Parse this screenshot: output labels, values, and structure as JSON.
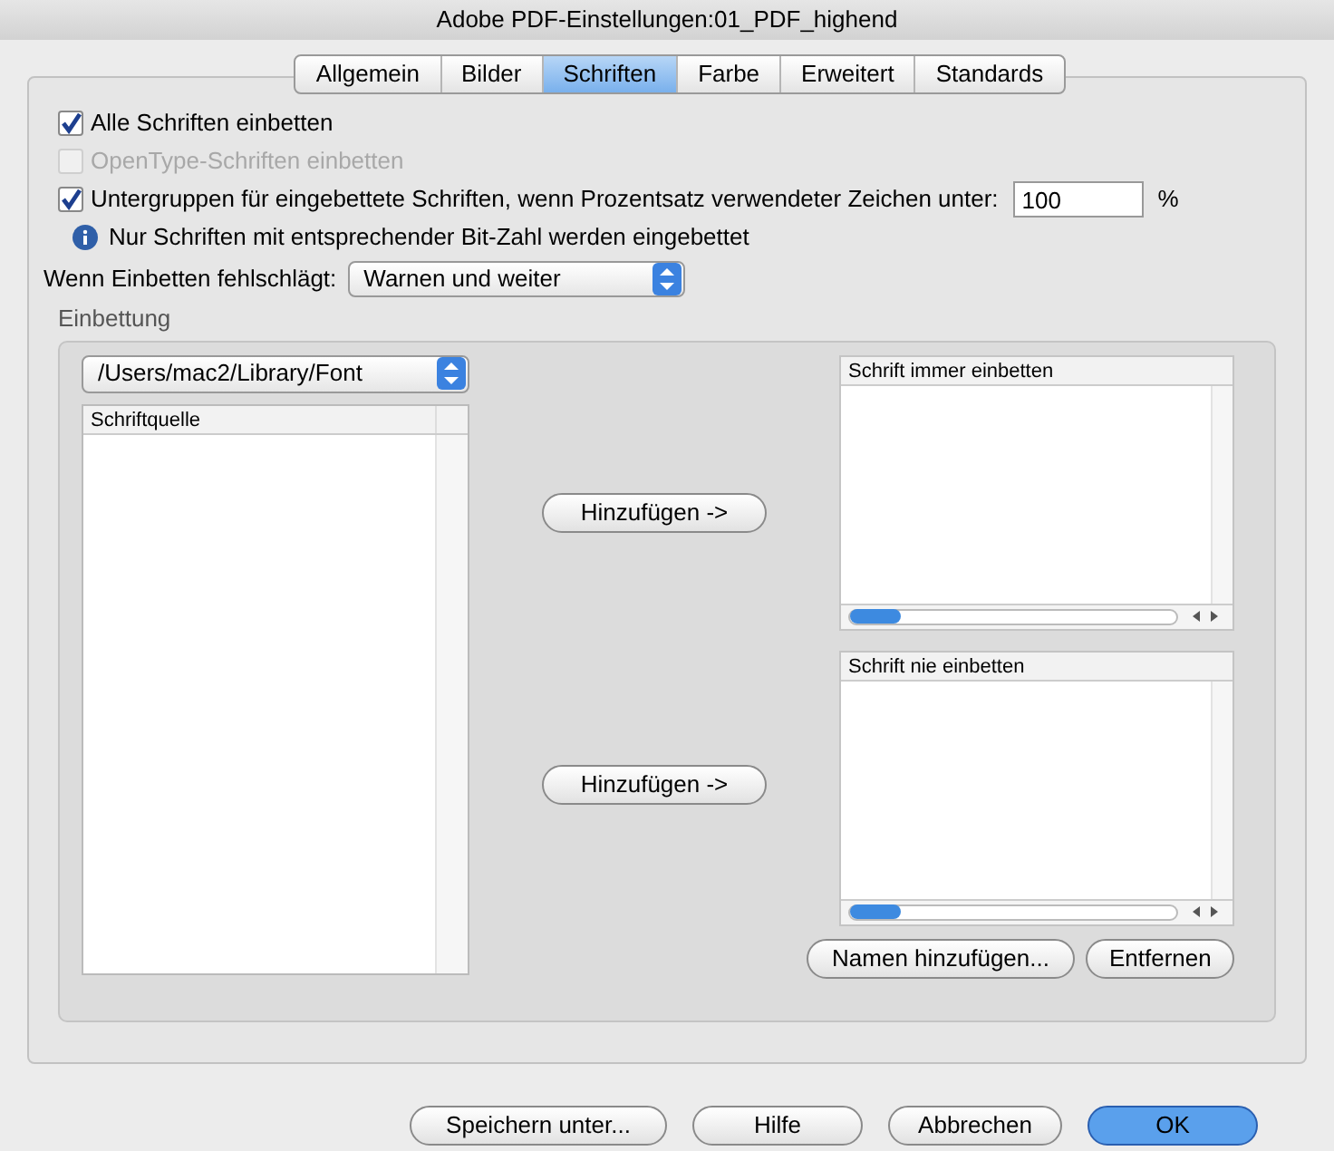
{
  "window": {
    "title": "Adobe PDF-Einstellungen:01_PDF_highend"
  },
  "tabs": [
    {
      "label": "Allgemein",
      "selected": false
    },
    {
      "label": "Bilder",
      "selected": false
    },
    {
      "label": "Schriften",
      "selected": true
    },
    {
      "label": "Farbe",
      "selected": false
    },
    {
      "label": "Erweitert",
      "selected": false
    },
    {
      "label": "Standards",
      "selected": false
    }
  ],
  "options": [
    {
      "kind": "checkbox",
      "label": "Alle Schriften einbetten",
      "checked": true,
      "disabled": false
    },
    {
      "kind": "checkbox",
      "label": "OpenType-Schriften einbetten",
      "checked": false,
      "disabled": true
    },
    {
      "kind": "checkbox_field",
      "label": "Untergruppen für eingebettete Schriften, wenn Prozentsatz verwendeter Zeichen unter:",
      "checked": true,
      "disabled": false,
      "value": "100",
      "unit": "%"
    },
    {
      "kind": "info",
      "label": "Nur Schriften mit entsprechender Bit-Zahl werden eingebettet"
    }
  ],
  "failure": {
    "label": "Wenn Einbetten fehlschlägt:",
    "value": "Warnen und weiter"
  },
  "embedding": {
    "title": "Einbettung",
    "folder": "/Users/mac2/Library/Font",
    "source_header": "Schriftquelle",
    "add_buttons": [
      "Hinzufügen ->",
      "Hinzufügen ->"
    ],
    "always_header": "Schrift immer einbetten",
    "never_header": "Schrift nie einbetten",
    "list_buttons": [
      "Namen hinzufügen...",
      "Entfernen"
    ]
  },
  "buttons": [
    {
      "label": "Speichern unter...",
      "default": false
    },
    {
      "label": "Hilfe",
      "default": false
    },
    {
      "label": "Abbrechen",
      "default": false
    },
    {
      "label": "OK",
      "default": true
    }
  ]
}
